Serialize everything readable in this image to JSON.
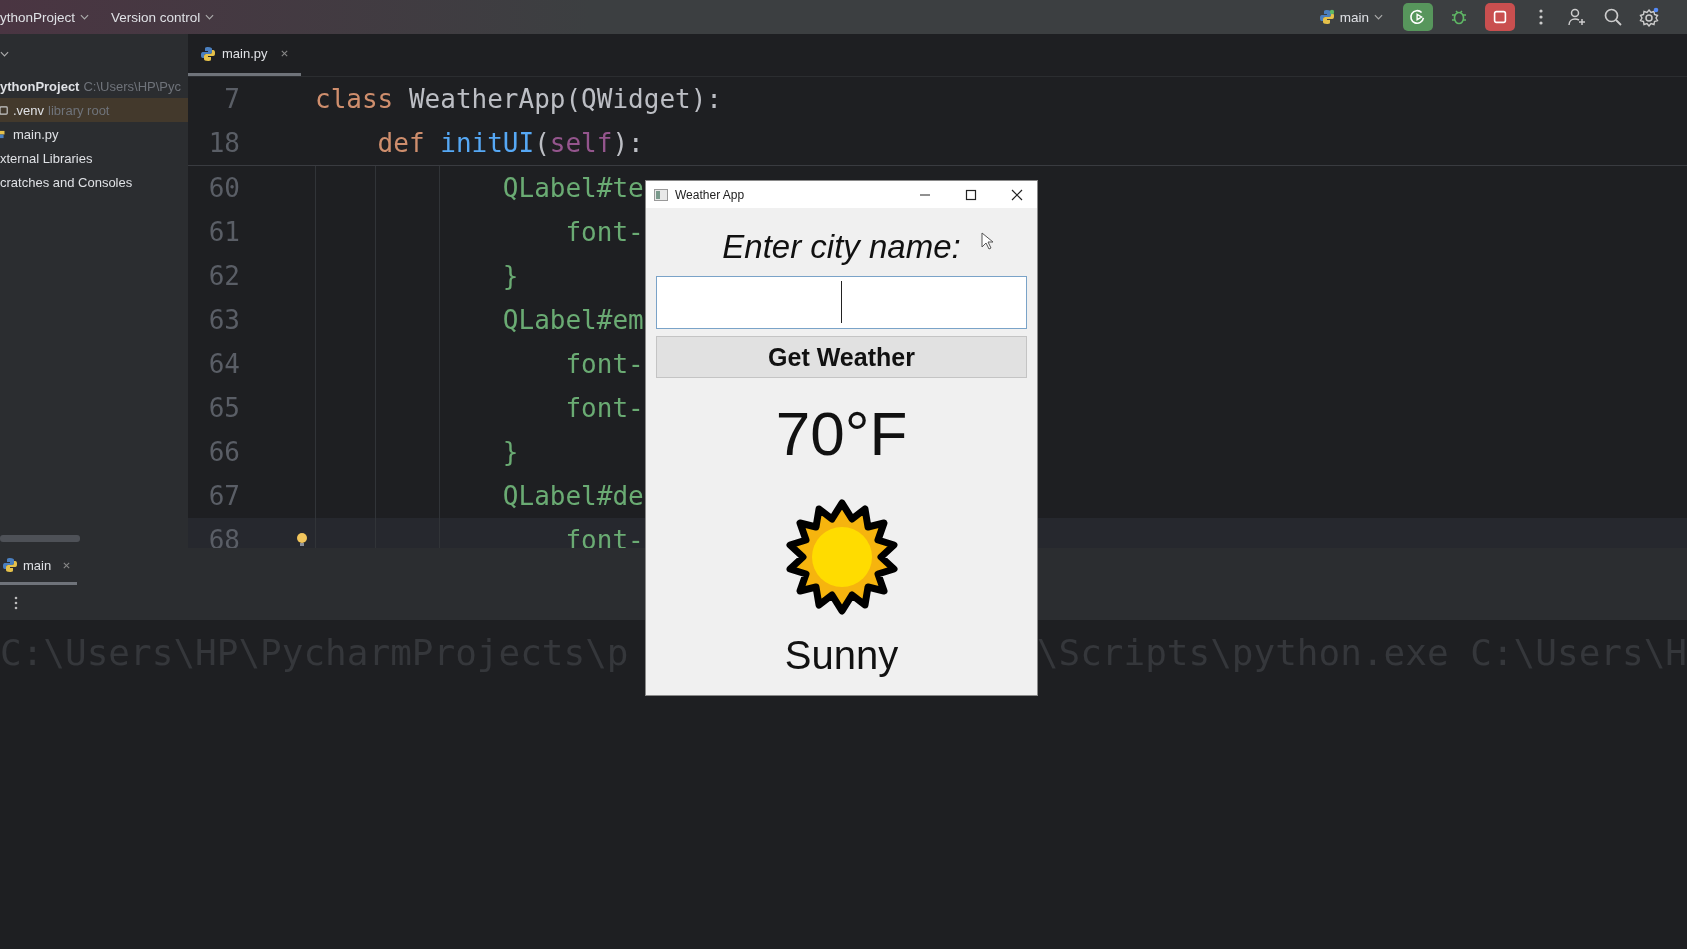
{
  "title_bar": {
    "project": "ythonProject",
    "vcs": "Version control",
    "run_config": "main"
  },
  "project_tree": {
    "items": [
      {
        "name": "ythonProject",
        "hint": "C:\\Users\\HP\\Pyc",
        "kind": "project",
        "selected": false
      },
      {
        "name": ".venv",
        "hint": "library root",
        "kind": "folder",
        "selected": true
      },
      {
        "name": "main.py",
        "kind": "python",
        "selected": false
      },
      {
        "name": "xternal Libraries",
        "kind": "library",
        "selected": false
      },
      {
        "name": "cratches and Consoles",
        "kind": "scratch",
        "selected": false
      }
    ]
  },
  "editor": {
    "tabs": [
      {
        "label": "main.py",
        "selected": true
      }
    ],
    "sticky_lines": [
      {
        "number": "7",
        "tokens": [
          {
            "text": "class",
            "kind": "keyword"
          },
          {
            "text": " WeatherApp(QWidget):",
            "kind": "plain"
          }
        ]
      },
      {
        "number": "18",
        "tokens": [
          {
            "text": "    def ",
            "kind": "keyword"
          },
          {
            "text": "initUI",
            "kind": "function"
          },
          {
            "text": "(",
            "kind": "plain"
          },
          {
            "text": "self",
            "kind": "self"
          },
          {
            "text": "):",
            "kind": "plain"
          }
        ]
      }
    ],
    "lines": [
      {
        "number": "60",
        "current": false,
        "tokens": [
          {
            "text": "            QLabel#te",
            "kind": "string"
          }
        ]
      },
      {
        "number": "61",
        "current": false,
        "tokens": [
          {
            "text": "                font-",
            "kind": "string"
          }
        ]
      },
      {
        "number": "62",
        "current": false,
        "tokens": [
          {
            "text": "            }",
            "kind": "string"
          }
        ]
      },
      {
        "number": "63",
        "current": false,
        "tokens": [
          {
            "text": "            QLabel#em",
            "kind": "string"
          }
        ]
      },
      {
        "number": "64",
        "current": false,
        "tokens": [
          {
            "text": "                font-",
            "kind": "string"
          }
        ]
      },
      {
        "number": "65",
        "current": false,
        "tokens": [
          {
            "text": "                font-",
            "kind": "string"
          }
        ]
      },
      {
        "number": "66",
        "current": false,
        "tokens": [
          {
            "text": "            }",
            "kind": "string"
          }
        ]
      },
      {
        "number": "67",
        "current": false,
        "tokens": [
          {
            "text": "            QLabel#de",
            "kind": "string"
          }
        ]
      },
      {
        "number": "68",
        "current": true,
        "tokens": [
          {
            "text": "                font-",
            "kind": "string"
          }
        ]
      }
    ]
  },
  "run_panel": {
    "tabs": [
      {
        "label": "main",
        "selected": true
      }
    ],
    "console_segments": [
      "C:\\Users\\HP\\PycharmProjects\\p",
      "\\Scripts\\python.exe C:\\Users\\H"
    ]
  },
  "weather_window": {
    "title": "Weather App",
    "prompt": "Enter city name:",
    "city_input": {
      "focused": true
    },
    "button": "Get Weather",
    "temperature": "70°F",
    "condition": "Sunny"
  }
}
